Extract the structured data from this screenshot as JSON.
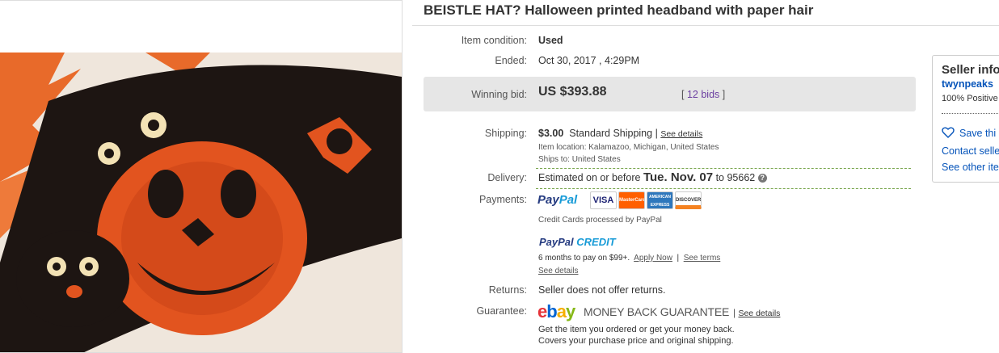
{
  "listing": {
    "title": "BEISTLE HAT? Halloween printed headband with paper hair"
  },
  "details": {
    "condition_label": "Item condition:",
    "condition_value": "Used",
    "ended_label": "Ended:",
    "ended_value": "Oct 30, 2017 , 4:29PM",
    "winning_label": "Winning bid:",
    "winning_value": "US $393.88",
    "bids_open": "[",
    "bids_link": "12 bids",
    "bids_close": "]",
    "shipping_label": "Shipping:",
    "shipping_cost": "$3.00",
    "shipping_method": "Standard Shipping",
    "shipping_sep": "|",
    "shipping_see_details": "See details",
    "item_location": "Item location:  Kalamazoo, Michigan, United States",
    "ships_to": "Ships to:  United States",
    "delivery_label": "Delivery:",
    "delivery_prefix": "Estimated on or before",
    "delivery_date": "Tue. Nov. 07",
    "delivery_suffix": "to 95662",
    "payments_label": "Payments:",
    "paypal_part1": "Pay",
    "paypal_part2": "Pal",
    "credit_cards_note": "Credit Cards processed by PayPal",
    "ppcredit_part1": "PayPal",
    "ppcredit_part2": "CREDIT",
    "ppcredit_terms": "6 months to pay on $99+.",
    "apply_now": "Apply Now",
    "terms_sep": "|",
    "see_terms": "See terms",
    "see_details2": "See details",
    "returns_label": "Returns:",
    "returns_value": "Seller does not offer returns.",
    "guarantee_label": "Guarantee:",
    "ebay_e": "e",
    "ebay_b": "b",
    "ebay_a": "a",
    "ebay_y": "y",
    "mbg_text": "MONEY BACK GUARANTEE",
    "guarantee_sep": "|",
    "guarantee_see_details": "See details",
    "guarantee_line1": "Get the item you ordered or get your money back.",
    "guarantee_line2": "Covers your purchase price and original shipping."
  },
  "cards": [
    {
      "name": "VISA",
      "fg": "#1a1f71",
      "bg": "#ffffff"
    },
    {
      "name": "MasterCard",
      "fg": "#ffffff",
      "bg": "#ff5f00"
    },
    {
      "name": "AMERICAN EXPRESS",
      "fg": "#ffffff",
      "bg": "#2e77bc"
    },
    {
      "name": "DISCOVER",
      "fg": "#333333",
      "bg": "#ffffff"
    }
  ],
  "seller": {
    "title": "Seller info",
    "name": "twynpeaks",
    "positive": "100% Positive",
    "save": "Save thi",
    "contact": "Contact selle",
    "see_other": "See other ite"
  },
  "colors": {
    "link": "#0654ba",
    "bids_link": "#6b3fa0",
    "bid_box": "#e6e6e6",
    "dashed_green": "#7aa74f"
  }
}
